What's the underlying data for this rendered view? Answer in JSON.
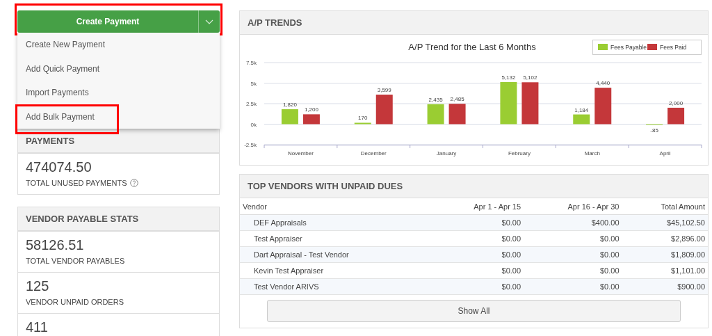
{
  "create_button": {
    "label": "Create Payment",
    "highlighted": true
  },
  "dropdown_menu": [
    {
      "label": "Create New Payment",
      "highlighted": false
    },
    {
      "label": "Add Quick Payment",
      "highlighted": false
    },
    {
      "label": "Import Payments",
      "highlighted": false
    },
    {
      "label": "Add Bulk Payment",
      "highlighted": true
    }
  ],
  "payments": {
    "title": "PAYMENTS",
    "stats": [
      {
        "value": "474074.50",
        "label": "TOTAL UNUSED PAYMENTS",
        "help": true
      }
    ]
  },
  "vendor_payable_stats": {
    "title": "VENDOR PAYABLE STATS",
    "stats": [
      {
        "value": "58126.51",
        "label": "TOTAL VENDOR PAYABLES",
        "help": false
      },
      {
        "value": "125",
        "label": "VENDOR UNPAID ORDERS",
        "help": false
      },
      {
        "value": "411",
        "help": false
      }
    ]
  },
  "ap_trends": {
    "title": "A/P TRENDS",
    "chart_data": {
      "type": "bar",
      "title": "A/P Trend for the Last 6 Months",
      "categories": [
        "November",
        "December",
        "January",
        "February",
        "March",
        "April"
      ],
      "series": [
        {
          "name": "Fees Payable",
          "color": "#9acd32",
          "values": [
            1820,
            170,
            2435,
            5132,
            1184,
            -85
          ]
        },
        {
          "name": "Fees Paid",
          "color": "#c4373a",
          "values": [
            1200,
            3599,
            2485,
            5102,
            4440,
            2000
          ]
        }
      ],
      "value_labels": [
        [
          "1,820",
          "170",
          "2,435",
          "5,132",
          "1,184",
          "-85"
        ],
        [
          "1,200",
          "3,599",
          "2,485",
          "5,102",
          "4,440",
          "2,000"
        ]
      ],
      "grid": true,
      "legend": "top-right",
      "ylim": [
        -2500,
        7500
      ],
      "yticks": [
        {
          "value": -2500,
          "label": "-2.5k"
        },
        {
          "value": 0,
          "label": "0k"
        },
        {
          "value": 2500,
          "label": "2.5k"
        },
        {
          "value": 5000,
          "label": "5k"
        },
        {
          "value": 7500,
          "label": "7.5k"
        }
      ]
    }
  },
  "top_vendors": {
    "title": "TOP VENDORS WITH UNPAID DUES",
    "columns": [
      "Vendor",
      "Apr 1 - Apr 15",
      "Apr 16 - Apr 30",
      "Total Amount"
    ],
    "rows": [
      [
        "DEF Appraisals",
        "$0.00",
        "$400.00",
        "$45,102.50"
      ],
      [
        "Test Appraiser",
        "$0.00",
        "$0.00",
        "$2,896.00"
      ],
      [
        "Dart Appraisal - Test Vendor",
        "$0.00",
        "$0.00",
        "$1,809.00"
      ],
      [
        "Kevin Test Appraiser",
        "$0.00",
        "$0.00",
        "$1,101.00"
      ],
      [
        "Test Vendor ARIVS",
        "$0.00",
        "$0.00",
        "$900.00"
      ]
    ],
    "show_all": "Show All"
  }
}
